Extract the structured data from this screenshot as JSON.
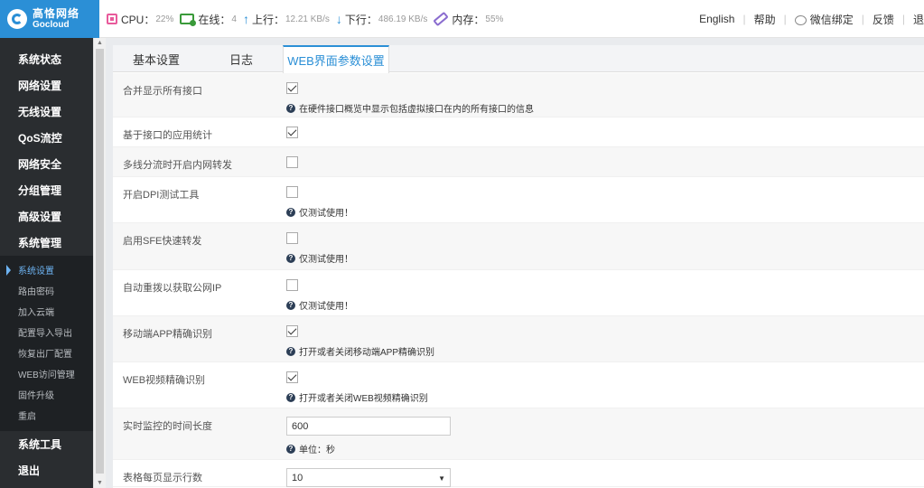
{
  "brand": {
    "name_cn": "高恪网络",
    "name_en": "Gocloud"
  },
  "stats": {
    "cpu_label": "CPU：",
    "cpu_value": "22%",
    "online_label": "在线：",
    "online_value": "4",
    "up_label": "上行：",
    "up_value": "12.21 KB/s",
    "down_label": "下行：",
    "down_value": "486.19 KB/s",
    "mem_label": "内存：",
    "mem_value": "55%"
  },
  "toplinks": {
    "english": "English",
    "help": "帮助",
    "wechat": "微信绑定",
    "feedback": "反馈",
    "logout": "退"
  },
  "sidebar": {
    "items": [
      "系统状态",
      "网络设置",
      "无线设置",
      "QoS流控",
      "网络安全",
      "分组管理",
      "高级设置",
      "系统管理"
    ],
    "sub_items": [
      "系统设置",
      "路由密码",
      "加入云端",
      "配置导入导出",
      "恢复出厂配置",
      "WEB访问管理",
      "固件升级",
      "重启"
    ],
    "bottom_items": [
      "系统工具",
      "退出"
    ]
  },
  "tabs": [
    "基本设置",
    "日志",
    "WEB界面参数设置"
  ],
  "rows": {
    "merge_iface": {
      "label": "合并显示所有接口",
      "checked": true,
      "hint": "在硬件接口概览中显示包括虚拟接口在内的所有接口的信息"
    },
    "iface_app_stats": {
      "label": "基于接口的应用统计",
      "checked": true
    },
    "multiline_fwd": {
      "label": "多线分流时开启内网转发",
      "checked": false
    },
    "dpi_tool": {
      "label": "开启DPI测试工具",
      "checked": false,
      "hint": "仅测试使用！"
    },
    "sfe_fwd": {
      "label": "启用SFE快速转发",
      "checked": false,
      "hint": "仅测试使用！"
    },
    "auto_redial": {
      "label": "自动重拨以获取公网IP",
      "checked": false,
      "hint": "仅测试使用！"
    },
    "mobile_app": {
      "label": "移动端APP精确识别",
      "checked": true,
      "hint": "打开或者关闭移动端APP精确识别"
    },
    "web_video": {
      "label": "WEB视频精确识别",
      "checked": true,
      "hint": "打开或者关闭WEB视频精确识别"
    },
    "monitor_time": {
      "label": "实时监控的时间长度",
      "value": "600",
      "hint": "单位：秒"
    },
    "page_rows": {
      "label": "表格每页显示行数",
      "value": "10"
    }
  },
  "colors": {
    "brand": "#2b8fd6",
    "sidebar": "#2a2d30",
    "active_sub": "#6db3f2"
  }
}
